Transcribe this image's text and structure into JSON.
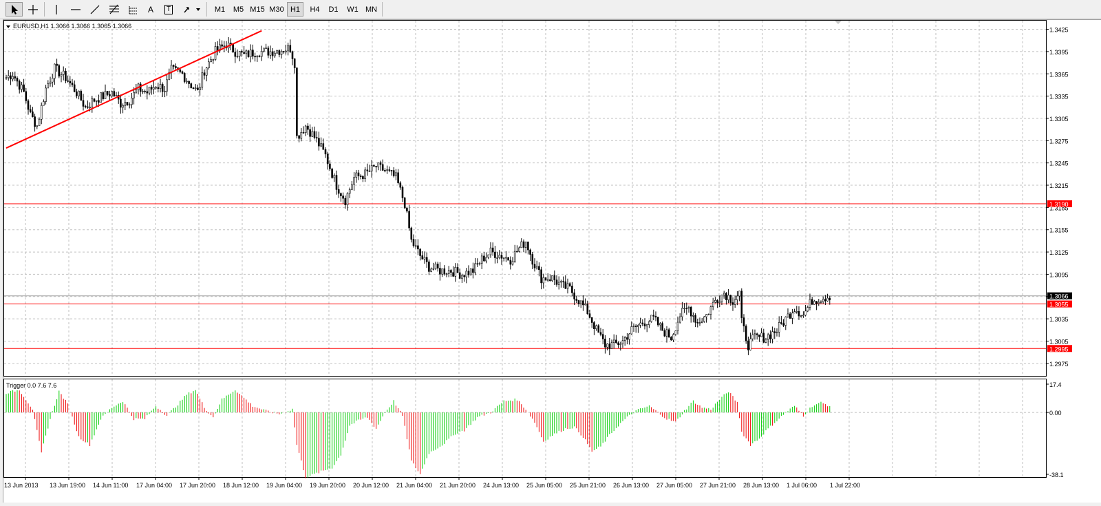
{
  "toolbar": {
    "tools": [
      "cursor-icon",
      "crosshair-icon",
      "vertical-line-icon",
      "horizontal-line-icon",
      "trendline-icon",
      "fibonacci-icon",
      "gann-fan-icon",
      "text-icon",
      "text-label-icon",
      "arrows-menu-icon"
    ],
    "text_tool_label": "A",
    "text_label_tool_label": "T",
    "timeframes": [
      "M1",
      "M5",
      "M15",
      "M30",
      "H1",
      "H4",
      "D1",
      "W1",
      "MN"
    ],
    "active_timeframe": "H1"
  },
  "chart": {
    "info_line": "EURUSD,H1  1.3066 1.3066 1.3065 1.3066",
    "y_ticks": [
      "1.3425",
      "1.3395",
      "1.3365",
      "1.3335",
      "1.3305",
      "1.3275",
      "1.3245",
      "1.3215",
      "1.3185",
      "1.3155",
      "1.3125",
      "1.3095",
      "1.3065",
      "1.3035",
      "1.3005",
      "1.2975"
    ],
    "levels": [
      {
        "label": "1.3190",
        "value": 1.319,
        "color": "#ff0000",
        "kind": "horizontal-line"
      },
      {
        "label": "1.3055",
        "value": 1.3055,
        "color": "#ff0000",
        "kind": "horizontal-line"
      },
      {
        "label": "1.2995",
        "value": 1.2995,
        "color": "#ff0000",
        "kind": "horizontal-line"
      },
      {
        "label": "1.3066",
        "value": 1.3066,
        "color": "#000000",
        "kind": "bid-line"
      }
    ],
    "x_labels": [
      "13 Jun 2013",
      "13 Jun 19:00",
      "14 Jun 11:00",
      "17 Jun 04:00",
      "17 Jun 20:00",
      "18 Jun 12:00",
      "19 Jun 04:00",
      "19 Jun 20:00",
      "20 Jun 12:00",
      "21 Jun 04:00",
      "21 Jun 20:00",
      "24 Jun 13:00",
      "25 Jun 05:00",
      "25 Jun 21:00",
      "26 Jun 13:00",
      "27 Jun 05:00",
      "27 Jun 21:00",
      "28 Jun 13:00",
      "1 Jul 06:00",
      "1 Jul 22:00"
    ],
    "indicator": {
      "label": "Trigger 0.0 7.6 7.6",
      "y_ticks": [
        "17.4",
        "0.00",
        "-38.1"
      ],
      "up_color": "#00cc00",
      "down_color": "#ee0000"
    }
  },
  "chart_data": {
    "type": "candlestick",
    "symbol": "EURUSD",
    "timeframe": "H1",
    "ylim": [
      1.296,
      1.3432
    ],
    "anchors": [
      [
        0,
        1.336
      ],
      [
        3,
        1.3365
      ],
      [
        8,
        1.334
      ],
      [
        11,
        1.331
      ],
      [
        14,
        1.3295
      ],
      [
        18,
        1.3345
      ],
      [
        22,
        1.3372
      ],
      [
        27,
        1.336
      ],
      [
        32,
        1.334
      ],
      [
        36,
        1.332
      ],
      [
        40,
        1.333
      ],
      [
        44,
        1.3335
      ],
      [
        48,
        1.334
      ],
      [
        52,
        1.3325
      ],
      [
        56,
        1.333
      ],
      [
        60,
        1.3345
      ],
      [
        64,
        1.334
      ],
      [
        68,
        1.335
      ],
      [
        72,
        1.3345
      ],
      [
        75,
        1.337
      ],
      [
        80,
        1.3365
      ],
      [
        84,
        1.335
      ],
      [
        87,
        1.334
      ],
      [
        90,
        1.337
      ],
      [
        95,
        1.3395
      ],
      [
        100,
        1.3405
      ],
      [
        104,
        1.3395
      ],
      [
        108,
        1.339
      ],
      [
        114,
        1.3395
      ],
      [
        120,
        1.3395
      ],
      [
        126,
        1.3398
      ],
      [
        129,
        1.34
      ],
      [
        131,
        1.338
      ],
      [
        132,
        1.328
      ],
      [
        136,
        1.3295
      ],
      [
        140,
        1.328
      ],
      [
        145,
        1.3255
      ],
      [
        150,
        1.3215
      ],
      [
        154,
        1.3195
      ],
      [
        158,
        1.3225
      ],
      [
        163,
        1.323
      ],
      [
        168,
        1.324
      ],
      [
        172,
        1.3235
      ],
      [
        177,
        1.3225
      ],
      [
        181,
        1.319
      ],
      [
        184,
        1.314
      ],
      [
        188,
        1.312
      ],
      [
        192,
        1.3105
      ],
      [
        197,
        1.31
      ],
      [
        202,
        1.31
      ],
      [
        207,
        1.3095
      ],
      [
        212,
        1.31
      ],
      [
        216,
        1.3115
      ],
      [
        220,
        1.3125
      ],
      [
        225,
        1.312
      ],
      [
        229,
        1.3115
      ],
      [
        233,
        1.313
      ],
      [
        236,
        1.314
      ],
      [
        239,
        1.3115
      ],
      [
        243,
        1.309
      ],
      [
        248,
        1.309
      ],
      [
        252,
        1.308
      ],
      [
        256,
        1.3075
      ],
      [
        260,
        1.306
      ],
      [
        264,
        1.3045
      ],
      [
        268,
        1.302
      ],
      [
        272,
        1.3
      ],
      [
        276,
        1.3
      ],
      [
        280,
        1.3005
      ],
      [
        284,
        1.302
      ],
      [
        289,
        1.303
      ],
      [
        294,
        1.3035
      ],
      [
        298,
        1.302
      ],
      [
        302,
        1.301
      ],
      [
        306,
        1.304
      ],
      [
        310,
        1.305
      ],
      [
        314,
        1.303
      ],
      [
        318,
        1.304
      ],
      [
        322,
        1.306
      ],
      [
        326,
        1.307
      ],
      [
        330,
        1.306
      ],
      [
        333,
        1.307
      ],
      [
        334,
        1.303
      ],
      [
        337,
        1.3
      ],
      [
        340,
        1.301
      ],
      [
        345,
        1.301
      ],
      [
        350,
        1.302
      ],
      [
        354,
        1.3035
      ],
      [
        358,
        1.305
      ],
      [
        362,
        1.304
      ],
      [
        366,
        1.306
      ],
      [
        370,
        1.3063
      ],
      [
        374,
        1.3066
      ]
    ],
    "horizontal_levels": [
      1.319,
      1.3055,
      1.2995
    ],
    "last_price": 1.3066,
    "trendline": {
      "from": [
        0,
        1.3265
      ],
      "to": [
        116,
        1.3423
      ]
    },
    "indicator": {
      "name": "Trigger",
      "params": [
        0.0,
        7.6,
        7.6
      ],
      "ylim": [
        -38.1,
        17.4
      ],
      "anchors": [
        [
          0,
          12
        ],
        [
          6,
          14
        ],
        [
          12,
          2
        ],
        [
          16,
          -25
        ],
        [
          20,
          -4
        ],
        [
          24,
          13
        ],
        [
          28,
          5
        ],
        [
          33,
          -15
        ],
        [
          38,
          -20
        ],
        [
          43,
          -4
        ],
        [
          48,
          3
        ],
        [
          53,
          7
        ],
        [
          58,
          -4
        ],
        [
          63,
          -4
        ],
        [
          68,
          4
        ],
        [
          73,
          -2
        ],
        [
          78,
          5
        ],
        [
          82,
          11
        ],
        [
          86,
          14
        ],
        [
          90,
          3
        ],
        [
          94,
          -3
        ],
        [
          98,
          8
        ],
        [
          104,
          14
        ],
        [
          108,
          9
        ],
        [
          112,
          4
        ],
        [
          118,
          1
        ],
        [
          124,
          -1
        ],
        [
          130,
          2
        ],
        [
          132,
          -20
        ],
        [
          136,
          -40
        ],
        [
          142,
          -37
        ],
        [
          148,
          -34
        ],
        [
          152,
          -26
        ],
        [
          156,
          -8
        ],
        [
          160,
          -5
        ],
        [
          164,
          -3
        ],
        [
          168,
          -10
        ],
        [
          172,
          0
        ],
        [
          176,
          7
        ],
        [
          180,
          -2
        ],
        [
          184,
          -30
        ],
        [
          188,
          -38
        ],
        [
          192,
          -25
        ],
        [
          198,
          -20
        ],
        [
          204,
          -13
        ],
        [
          208,
          -11
        ],
        [
          214,
          -3
        ],
        [
          220,
          0
        ],
        [
          226,
          7
        ],
        [
          232,
          8
        ],
        [
          236,
          2
        ],
        [
          240,
          -6
        ],
        [
          244,
          -18
        ],
        [
          248,
          -14
        ],
        [
          254,
          -10
        ],
        [
          258,
          -9
        ],
        [
          262,
          -15
        ],
        [
          266,
          -24
        ],
        [
          270,
          -21
        ],
        [
          274,
          -14
        ],
        [
          278,
          -8
        ],
        [
          282,
          -3
        ],
        [
          286,
          1
        ],
        [
          292,
          4
        ],
        [
          296,
          0
        ],
        [
          300,
          -4
        ],
        [
          304,
          -6
        ],
        [
          308,
          1
        ],
        [
          312,
          7
        ],
        [
          316,
          3
        ],
        [
          320,
          2
        ],
        [
          324,
          8
        ],
        [
          328,
          13
        ],
        [
          332,
          6
        ],
        [
          334,
          -12
        ],
        [
          338,
          -20
        ],
        [
          342,
          -16
        ],
        [
          346,
          -10
        ],
        [
          350,
          -5
        ],
        [
          354,
          0
        ],
        [
          358,
          4
        ],
        [
          362,
          -2
        ],
        [
          366,
          4
        ],
        [
          370,
          6
        ],
        [
          374,
          4
        ]
      ]
    }
  }
}
